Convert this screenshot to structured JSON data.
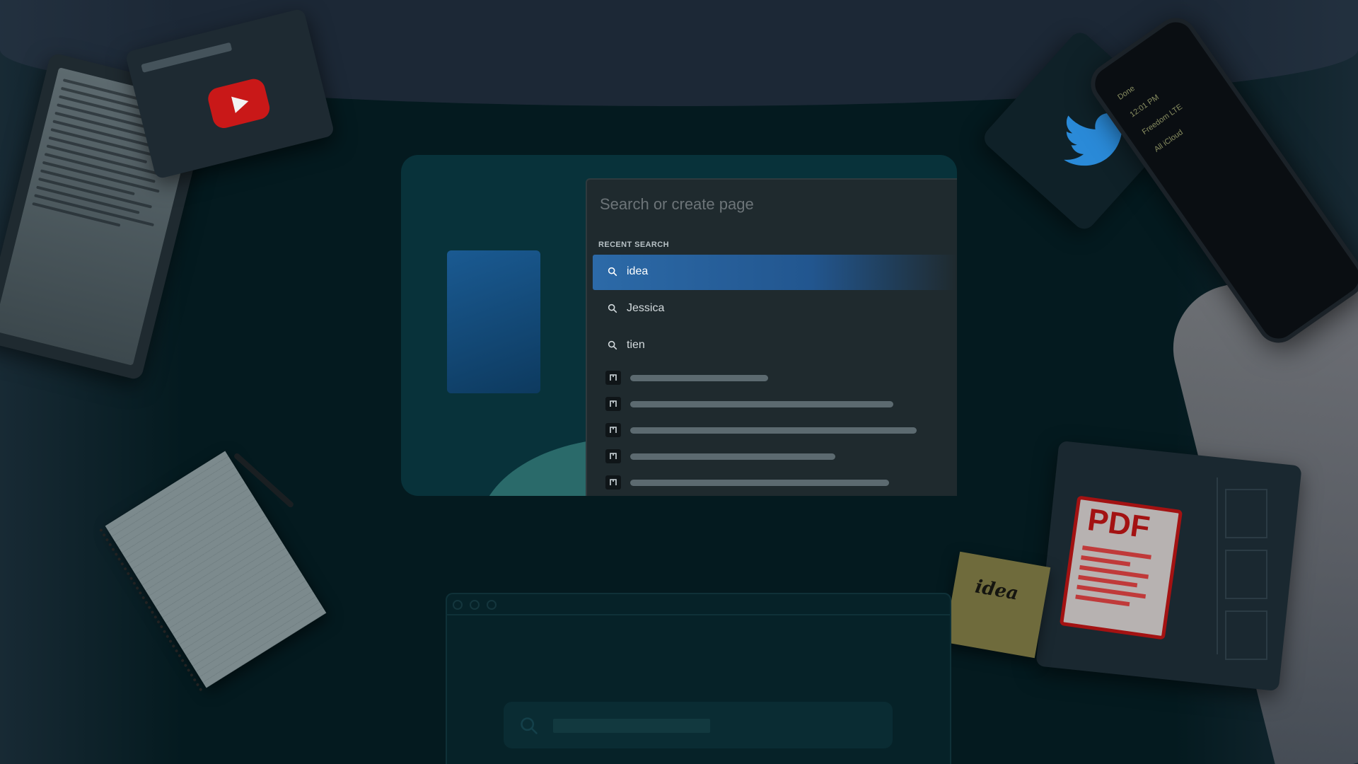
{
  "search_panel": {
    "placeholder": "Search or create page",
    "section_heading": "RECENT SEARCH",
    "recent_searches": [
      {
        "label": "idea",
        "active": true
      },
      {
        "label": "Jessica",
        "active": false
      },
      {
        "label": "tien",
        "active": false
      }
    ],
    "page_result_count": 5
  },
  "decor": {
    "sticky_note_text": "idea",
    "pdf_label": "PDF",
    "phone_back_label": "All iCloud",
    "phone_done_label": "Done",
    "phone_carrier": "Freedom LTE",
    "phone_time": "12:01 PM"
  },
  "colors": {
    "background": "#041a1f",
    "accent_blue": "#2c6aa8",
    "panel": "#1f2a2e",
    "youtube_red": "#c91818",
    "twitter_blue": "#2a8ad8",
    "pdf_red": "#a31212"
  },
  "icons": {
    "search": "search-icon",
    "page": "page-icon",
    "play": "play-icon",
    "twitter": "twitter-bird-icon"
  }
}
